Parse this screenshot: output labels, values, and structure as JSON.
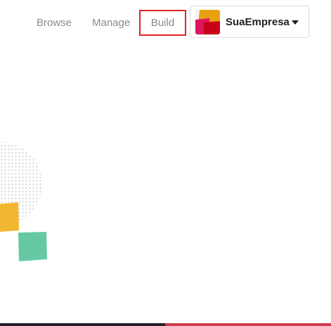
{
  "nav": {
    "browse_label": "Browse",
    "manage_label": "Manage",
    "build_label": "Build"
  },
  "company": {
    "name": "SuaEmpresa",
    "logo_colors": [
      "#e8a010",
      "#e01560",
      "#c8001a"
    ]
  },
  "colors": {
    "highlight_border": "#e02424",
    "decor_yellow": "#f2b731",
    "decor_green": "#66c9a3",
    "decor_dots": "#cfd3d6",
    "bottom_bar_dark": "#2b1f2e",
    "bottom_bar_red": "#cf3a4a"
  },
  "icons": {
    "dropdown": "caret-down-icon"
  }
}
